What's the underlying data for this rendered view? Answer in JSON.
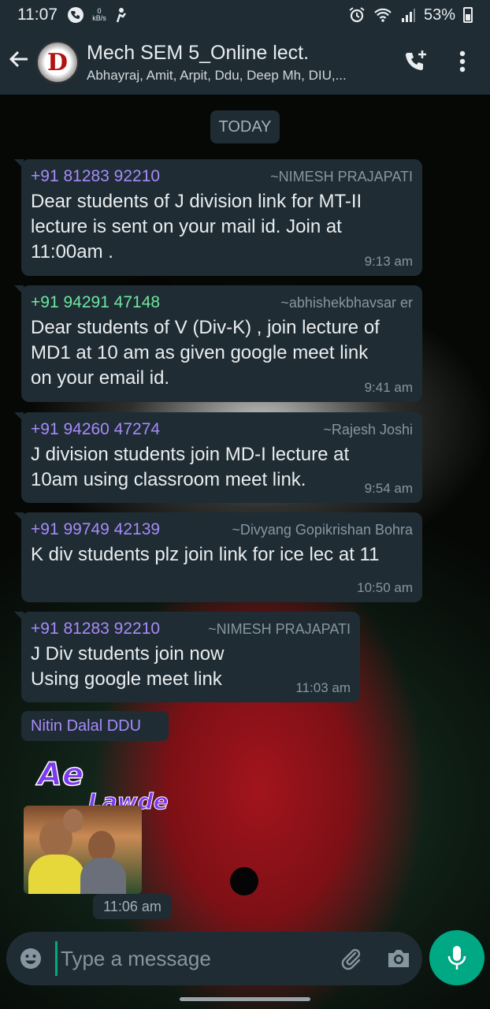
{
  "status_bar": {
    "time": "11:07",
    "data_speed": "0 kB/s",
    "battery": "53%"
  },
  "header": {
    "group_name": "Mech SEM 5_Online lect.",
    "members": "Abhayraj, Amit, Arpit, Ddu, Deep Mh, DIU,...",
    "avatar_text": "D"
  },
  "date_divider": "TODAY",
  "messages": [
    {
      "phone": "+91 81283 92210",
      "alias": "~NIMESH PRAJAPATI",
      "text": "Dear students  of J division link for MT-II\nlecture is sent on your mail id. Join at\n11:00am .",
      "time": "9:13 am",
      "phone_color": "#a78bfa"
    },
    {
      "phone": "+91 94291 47148",
      "alias": "~abhishekbhavsar er",
      "text": "Dear students of V (Div-K) , join lecture of\nMD1 at 10 am as given google meet link\non your email id.",
      "time": "9:41 am",
      "phone_color": "#6ee7a0"
    },
    {
      "phone": "+91 94260 47274",
      "alias": "~Rajesh Joshi",
      "text": "J division students join MD-I lecture at\n10am using classroom meet link.",
      "time": "9:54 am",
      "phone_color": "#a78bfa"
    },
    {
      "phone": "+91 99749 42139",
      "alias": "~Divyang Gopikrishan Bohra",
      "text": "K div students plz join link for ice lec at 11",
      "time": "10:50 am",
      "phone_color": "#a78bfa"
    },
    {
      "phone": "+91 81283 92210",
      "alias": "~NIMESH PRAJAPATI",
      "text": "J Div students join now\nUsing google meet link",
      "time": "11:03 am",
      "phone_color": "#a78bfa"
    }
  ],
  "sticker_message": {
    "sender": "Nitin Dalal DDU",
    "sticker_text_1": "Ae",
    "sticker_text_2": "Lawde",
    "time": "11:06 am"
  },
  "input": {
    "placeholder": "Type a message"
  },
  "colors": {
    "accent": "#00a884",
    "bubble": "#1f2c34",
    "sender_purple": "#a78bfa"
  }
}
